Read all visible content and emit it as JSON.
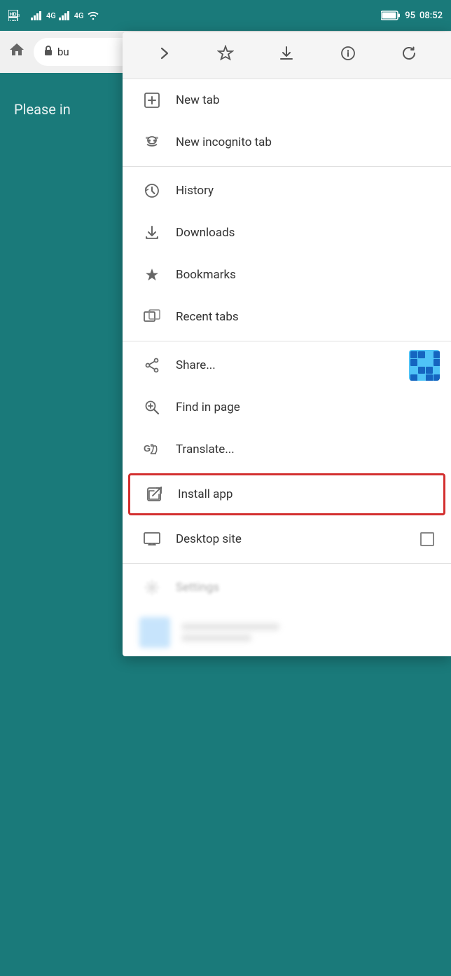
{
  "statusBar": {
    "leftIcons": [
      "HD-icon",
      "signal1-icon",
      "4g-icon",
      "signal2-icon",
      "4g2-icon",
      "wifi-icon"
    ],
    "battery": "95",
    "time": "08:52"
  },
  "browserBar": {
    "homeLabel": "⌂",
    "lockIcon": "🔒",
    "addressText": "bu"
  },
  "bgContent": {
    "text": "Please in"
  },
  "menuToolbar": {
    "forwardLabel": "→",
    "bookmarkLabel": "☆",
    "downloadLabel": "⬇",
    "infoLabel": "ⓘ",
    "refreshLabel": "↻"
  },
  "menuItems": [
    {
      "id": "new-tab",
      "icon": "new-tab-icon",
      "label": "New tab",
      "hasDividerAfter": false
    },
    {
      "id": "new-incognito-tab",
      "icon": "incognito-icon",
      "label": "New incognito tab",
      "hasDividerAfter": true
    },
    {
      "id": "history",
      "icon": "history-icon",
      "label": "History",
      "hasDividerAfter": false
    },
    {
      "id": "downloads",
      "icon": "downloads-icon",
      "label": "Downloads",
      "hasDividerAfter": false
    },
    {
      "id": "bookmarks",
      "icon": "bookmarks-icon",
      "label": "Bookmarks",
      "hasDividerAfter": false
    },
    {
      "id": "recent-tabs",
      "icon": "recent-tabs-icon",
      "label": "Recent tabs",
      "hasDividerAfter": true
    },
    {
      "id": "share",
      "icon": "share-icon",
      "label": "Share...",
      "hasDividerAfter": false,
      "hasQRBadge": true
    },
    {
      "id": "find-in-page",
      "icon": "find-icon",
      "label": "Find in page",
      "hasDividerAfter": false
    },
    {
      "id": "translate",
      "icon": "translate-icon",
      "label": "Translate...",
      "hasDividerAfter": false
    },
    {
      "id": "install-app",
      "icon": "install-app-icon",
      "label": "Install app",
      "highlighted": true,
      "hasDividerAfter": false
    },
    {
      "id": "desktop-site",
      "icon": "desktop-icon",
      "label": "Desktop site",
      "hasCheckbox": true,
      "hasDividerAfter": true
    },
    {
      "id": "settings",
      "icon": "settings-icon",
      "label": "Settings",
      "blurred": true,
      "hasDividerAfter": false
    }
  ],
  "colors": {
    "background": "#1a7a7a",
    "menuBg": "#ffffff",
    "accent": "#d32f2f",
    "iconColor": "#666666",
    "textColor": "#333333"
  }
}
